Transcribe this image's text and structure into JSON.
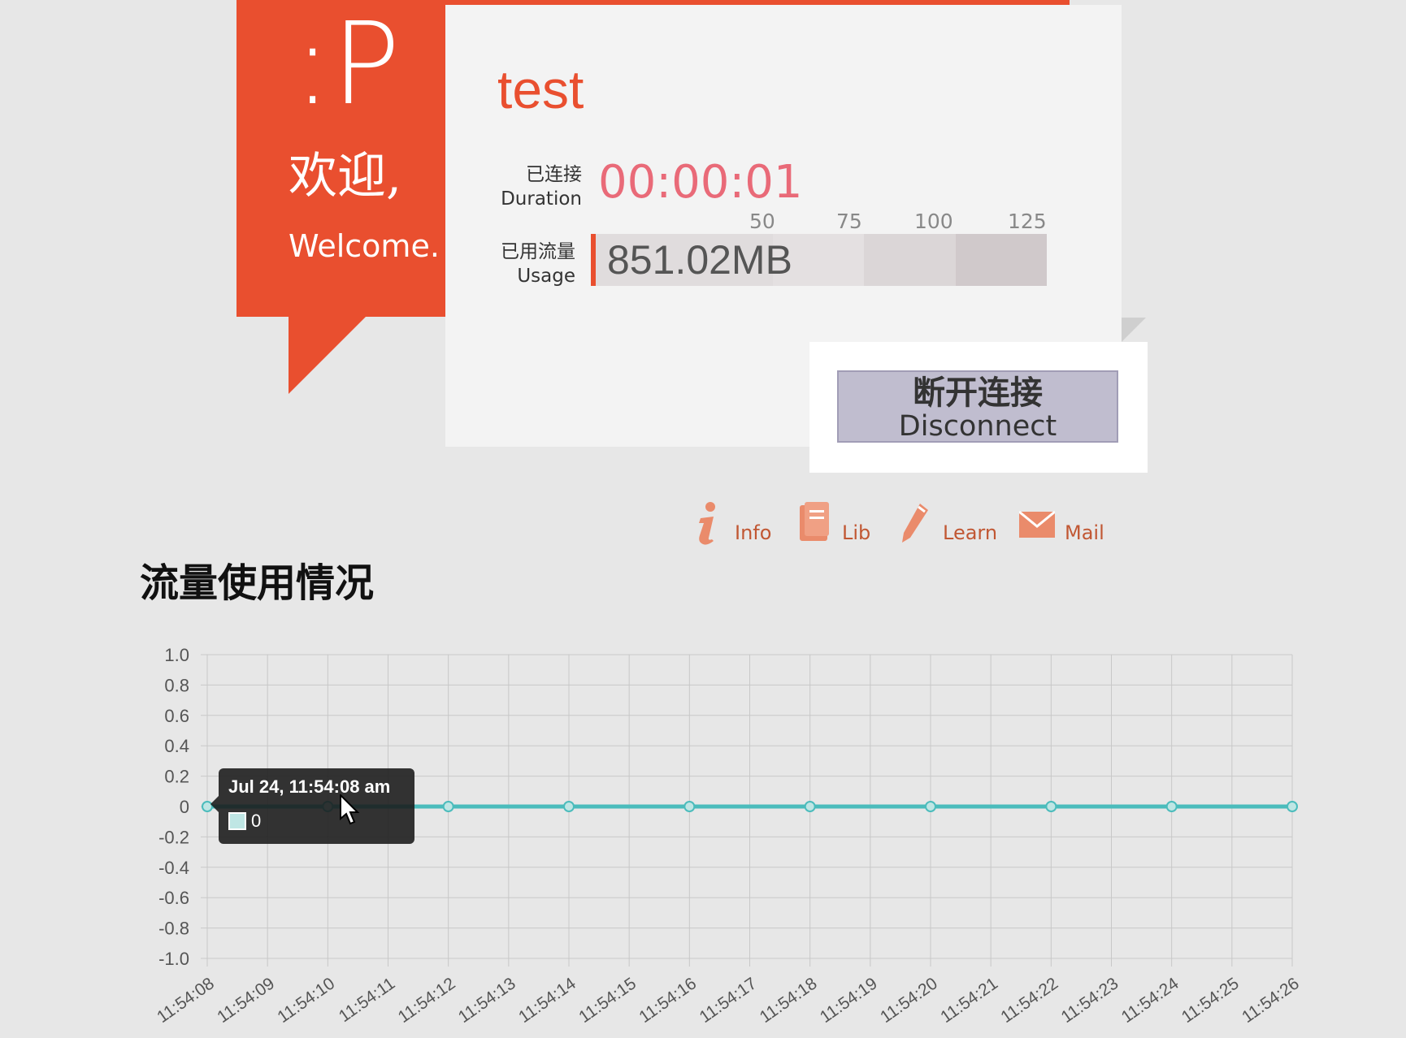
{
  "header": {
    "logo_text": ":P",
    "welcome_cn": "欢迎,",
    "welcome_en": "Welcome.",
    "username": "test"
  },
  "stats": {
    "duration_label_cn": "已连接",
    "duration_label_en": "Duration",
    "duration_value": "00:00:01",
    "usage_label_cn": "已用流量",
    "usage_label_en": "Usage",
    "usage_value": "851.02MB",
    "usage_scale": [
      "50",
      "75",
      "100",
      "125"
    ]
  },
  "disconnect": {
    "label_cn": "断开连接",
    "label_en": "Disconnect"
  },
  "quick_links": [
    {
      "label": "Info",
      "icon": "info-icon"
    },
    {
      "label": "Lib",
      "icon": "book-icon"
    },
    {
      "label": "Learn",
      "icon": "pencil-icon"
    },
    {
      "label": "Mail",
      "icon": "mail-icon"
    }
  ],
  "section_title": "流量使用情况",
  "colors": {
    "accent": "#e94f2f",
    "line": "#4bbcbc",
    "duration_text": "#e96a78",
    "button_bg": "#c0bdcf"
  },
  "chart_data": {
    "type": "line",
    "x": [
      "11:54:08",
      "11:54:09",
      "11:54:10",
      "11:54:11",
      "11:54:12",
      "11:54:13",
      "11:54:14",
      "11:54:15",
      "11:54:16",
      "11:54:17",
      "11:54:18",
      "11:54:19",
      "11:54:20",
      "11:54:21",
      "11:54:22",
      "11:54:23",
      "11:54:24",
      "11:54:25",
      "11:54:26"
    ],
    "series": [
      {
        "name": "0",
        "x": [
          "11:54:08",
          "11:54:10",
          "11:54:12",
          "11:54:14",
          "11:54:16",
          "11:54:18",
          "11:54:20",
          "11:54:22",
          "11:54:24",
          "11:54:26"
        ],
        "values": [
          0,
          0,
          0,
          0,
          0,
          0,
          0,
          0,
          0,
          0
        ]
      }
    ],
    "yticks": [
      "1.0",
      "0.8",
      "0.6",
      "0.4",
      "0.2",
      "0",
      "-0.2",
      "-0.4",
      "-0.6",
      "-0.8",
      "-1.0"
    ],
    "ylim": [
      -1.0,
      1.0
    ],
    "grid": true,
    "tooltip": {
      "title": "Jul 24, 11:54:08 am",
      "value": "0"
    }
  }
}
